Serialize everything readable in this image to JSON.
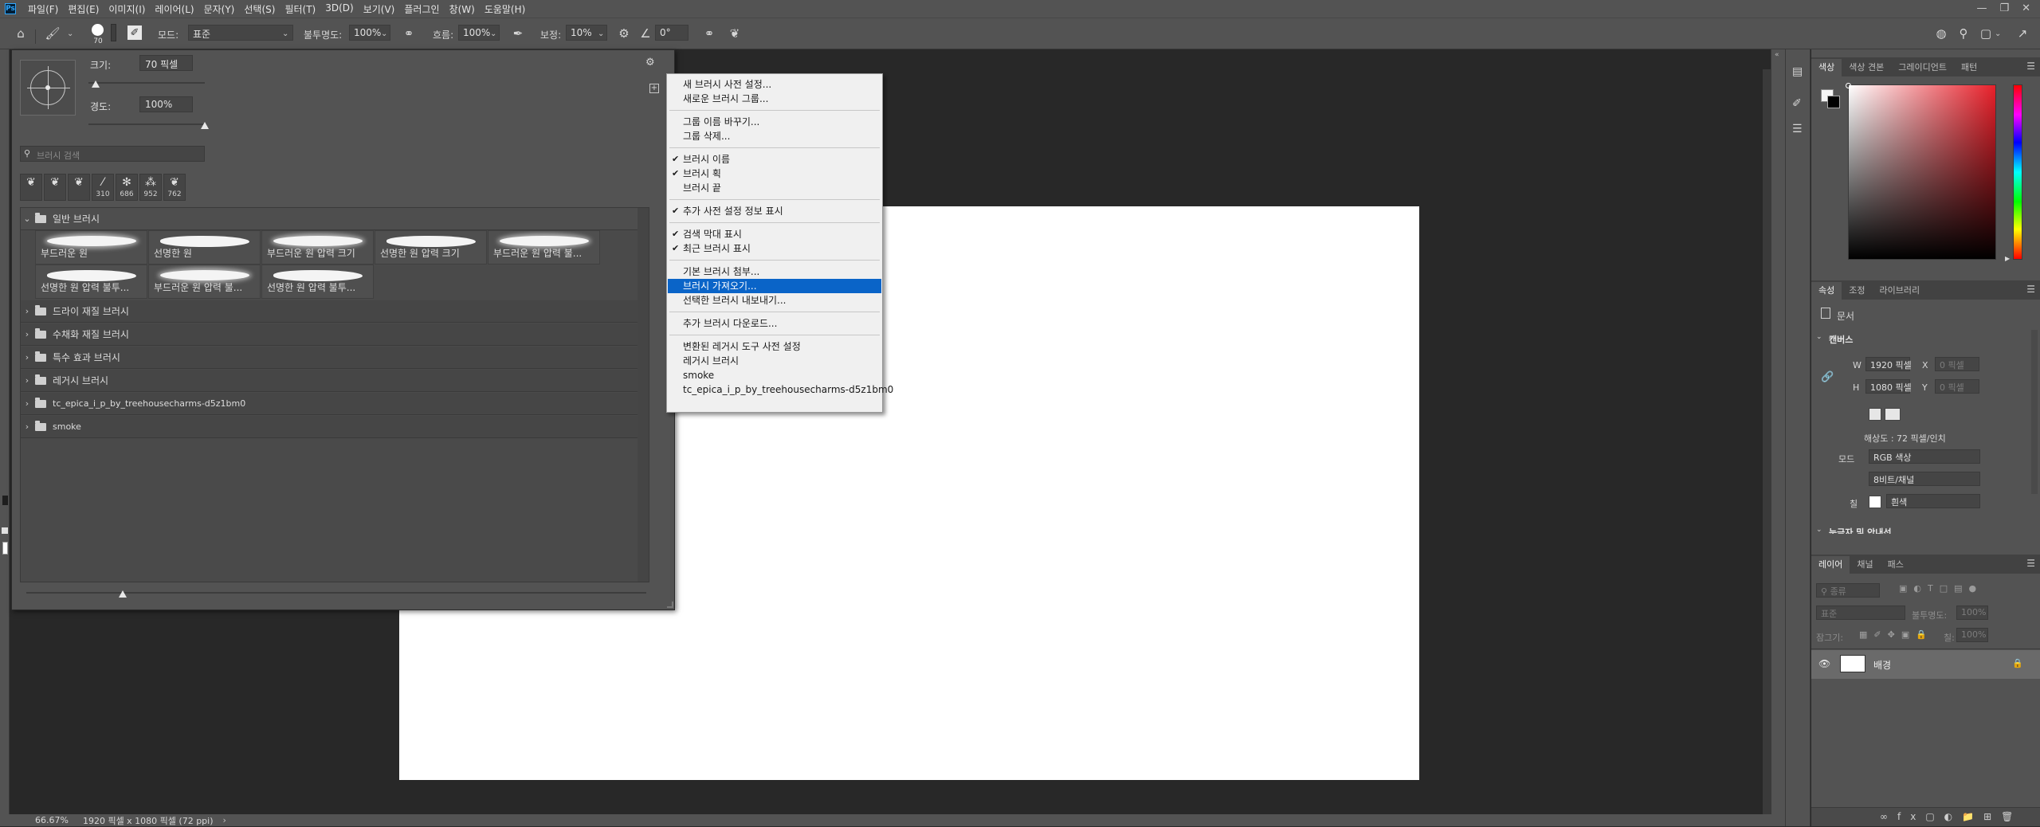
{
  "menubar": {
    "items": [
      "파일(F)",
      "편집(E)",
      "이미지(I)",
      "레이어(L)",
      "문자(Y)",
      "선택(S)",
      "필터(T)",
      "3D(D)",
      "보기(V)",
      "플러그인",
      "창(W)",
      "도움말(H)"
    ]
  },
  "options": {
    "brush_size": "70",
    "mode_label": "모드:",
    "mode_value": "표준",
    "opacity_label": "불투명도:",
    "opacity_value": "100%",
    "flow_label": "흐름:",
    "flow_value": "100%",
    "smoothing_label": "보정:",
    "smoothing_value": "10%",
    "angle_value": "0°"
  },
  "brush_panel": {
    "size_label": "크기:",
    "size_value": "70 픽셀",
    "size_slider_fraction": 0.06,
    "hardness_label": "경도:",
    "hardness_value": "100%",
    "hardness_slider_fraction": 1.0,
    "search_placeholder": "브러시 검색",
    "recent_tips": [
      {
        "glyph": "❦",
        "count": ""
      },
      {
        "glyph": "❦",
        "count": ""
      },
      {
        "glyph": "❦",
        "count": ""
      },
      {
        "glyph": "⁄",
        "count": "310"
      },
      {
        "glyph": "✻",
        "count": "686"
      },
      {
        "glyph": "⁂",
        "count": "952"
      },
      {
        "glyph": "❦",
        "count": "762"
      }
    ],
    "open_group": "일반 브러시",
    "brushes": [
      "부드러운 원",
      "선명한 원",
      "부드러운 원 압력 크기",
      "선명한 원 압력 크기",
      "부드러운 원 압력 불...",
      "선명한 원 압력 불투...",
      "부드러운 원 압력 불...",
      "선명한 원 압력 불투..."
    ],
    "groups": [
      "드라이 재질 브러시",
      "수채화 재질 브러시",
      "특수 효과 브러시",
      "레거시 브러시",
      "tc_epica_i_p_by_treehousecharms-d5z1bm0",
      "smoke"
    ]
  },
  "context_menu": {
    "items": [
      {
        "label": "새 브러시 사전 설정...",
        "checked": false
      },
      {
        "label": "새로운 브러시 그룹...",
        "checked": false
      },
      {
        "sep": true
      },
      {
        "label": "그룹 이름 바꾸기...",
        "checked": false
      },
      {
        "label": "그룹 삭제...",
        "checked": false
      },
      {
        "sep": true
      },
      {
        "label": "브러시 이름",
        "checked": true
      },
      {
        "label": "브러시 획",
        "checked": true
      },
      {
        "label": "브러시 끝",
        "checked": false
      },
      {
        "sep": true
      },
      {
        "label": "추가 사전 설정 정보 표시",
        "checked": true
      },
      {
        "sep": true
      },
      {
        "label": "검색 막대 표시",
        "checked": true
      },
      {
        "label": "최근 브러시 표시",
        "checked": true
      },
      {
        "sep": true
      },
      {
        "label": "기본 브러시 첨부...",
        "checked": false
      },
      {
        "label": "브러시 가져오기...",
        "checked": false,
        "highlighted": true
      },
      {
        "label": "선택한 브러시 내보내기...",
        "checked": false
      },
      {
        "sep": true
      },
      {
        "label": "추가 브러시 다운로드...",
        "checked": false
      },
      {
        "sep": true
      },
      {
        "label": "변환된 레거시 도구 사전 설정",
        "checked": false
      },
      {
        "label": "레거시 브러시",
        "checked": false
      },
      {
        "label": "smoke",
        "checked": false
      },
      {
        "label": "tc_epica_i_p_by_treehousecharms-d5z1bm0",
        "checked": false
      }
    ]
  },
  "color_panel": {
    "tabs": [
      "색상",
      "색상 견본",
      "그레이디언트",
      "패턴"
    ],
    "hue_color": "#e8202a"
  },
  "properties_panel": {
    "tabs": [
      "속성",
      "조정",
      "라이브러리"
    ],
    "doc_label": "문서",
    "canvas_section": "캔버스",
    "w_label": "W",
    "w_value": "1920 픽셀",
    "x_label": "X",
    "x_placeholder": "0 픽셀",
    "h_label": "H",
    "h_value": "1080 픽셀",
    "y_label": "Y",
    "y_placeholder": "0 픽셀",
    "resolution": "해상도 : 72 픽셀/인치",
    "mode_label": "모드",
    "mode_value": "RGB 색상",
    "depth_value": "8비트/채널",
    "fill_label": "칠",
    "fill_value": "흰색",
    "next_section": "눈금자 및 안내선"
  },
  "layers_panel": {
    "tabs": [
      "레이어",
      "채널",
      "패스"
    ],
    "filter_placeholder": "종류",
    "blend_mode": "표준",
    "opacity_label": "불투명도:",
    "opacity_value": "100%",
    "lock_label": "잠그기:",
    "fill_label": "칠:",
    "fill_value": "100%",
    "layer_name": "배경"
  },
  "status": {
    "zoom": "66.67%",
    "doc_info": "1920 픽셀 x 1080 픽셀 (72 ppi)"
  }
}
